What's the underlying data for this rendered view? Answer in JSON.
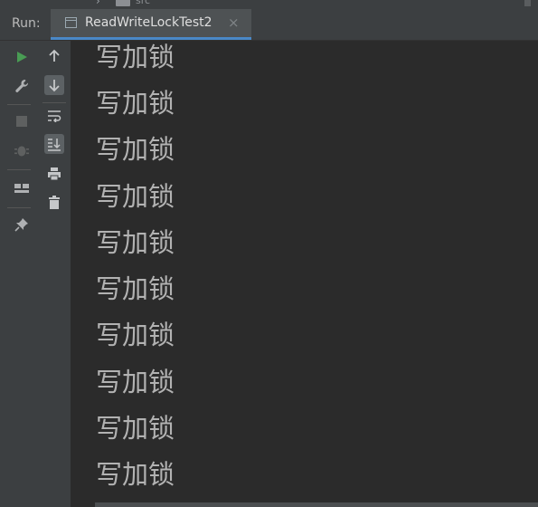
{
  "top_strip": {
    "folder_text": "src"
  },
  "run_panel": {
    "label": "Run:",
    "tab": {
      "title": "ReadWriteLockTest2",
      "close": "×",
      "icon": "run-config-window-icon"
    }
  },
  "left_toolbar": [
    {
      "name": "rerun-icon",
      "color": "#499c54"
    },
    {
      "name": "wrench-icon",
      "color": "#afb1b3"
    },
    {
      "name": "stop-icon",
      "color": "#5e6060"
    },
    {
      "name": "debug-bug-icon",
      "color": "#5e6060"
    },
    {
      "name": "layout-icon",
      "color": "#afb1b3"
    },
    {
      "name": "pin-icon",
      "color": "#afb1b3"
    }
  ],
  "console_toolbar": [
    {
      "name": "arrow-up-icon"
    },
    {
      "name": "arrow-down-icon",
      "active": true
    },
    {
      "name": "soft-wrap-icon"
    },
    {
      "name": "scroll-to-end-icon",
      "active": true
    },
    {
      "name": "print-icon"
    },
    {
      "name": "trash-icon"
    }
  ],
  "console": {
    "lines": [
      "写加锁",
      "写加锁",
      "写加锁",
      "写加锁",
      "写加锁",
      "写加锁",
      "写加锁",
      "写加锁",
      "写加锁",
      "写加锁"
    ]
  },
  "colors": {
    "panel_bg": "#3c3f41",
    "console_bg": "#2b2b2b",
    "tab_accent": "#4a88c7",
    "console_text": "#b2b2b2"
  }
}
